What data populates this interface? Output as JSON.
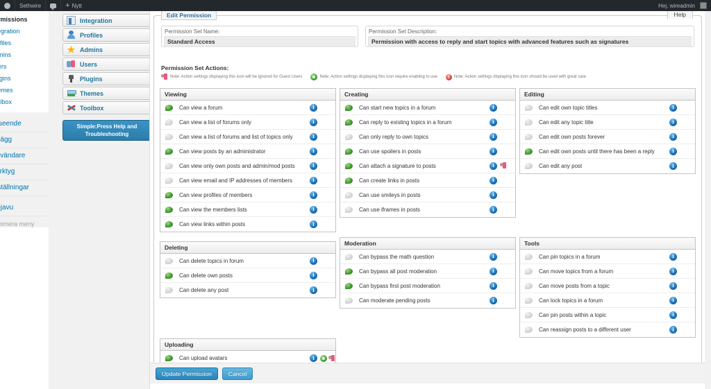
{
  "adminbar": {
    "site_name": "Sethwire",
    "comments_icon": "comment-icon",
    "new_label": "Nytt",
    "greeting": "Hej, wireadmin",
    "wp_logo_icon": "wordpress-logo-icon",
    "avatar_icon": "avatar-icon"
  },
  "wpmenu": {
    "submenu": [
      {
        "label": "Permissions",
        "current": true
      },
      {
        "label": "Integration",
        "current": false
      },
      {
        "label": "Profiles",
        "current": false
      },
      {
        "label": "Admins",
        "current": false
      },
      {
        "label": "Users",
        "current": false
      },
      {
        "label": "Plugins",
        "current": false
      },
      {
        "label": "Themes",
        "current": false
      },
      {
        "label": "Toolbox",
        "current": false
      }
    ],
    "lower": [
      {
        "label": "Utseende"
      },
      {
        "label": "Tillägg"
      },
      {
        "label": "Användare"
      },
      {
        "label": "Verktyg"
      },
      {
        "label": "Inställningar"
      }
    ],
    "plugin_menu": {
      "label": "Dejavu"
    },
    "collapse": {
      "label": "Minimera meny"
    }
  },
  "spnav": {
    "items": [
      {
        "label": "Integration",
        "icon": "integration-icon"
      },
      {
        "label": "Profiles",
        "icon": "profiles-icon"
      },
      {
        "label": "Admins",
        "icon": "admins-star-icon"
      },
      {
        "label": "Users",
        "icon": "users-icon"
      },
      {
        "label": "Plugins",
        "icon": "plugins-plug-icon"
      },
      {
        "label": "Themes",
        "icon": "themes-icon"
      },
      {
        "label": "Toolbox",
        "icon": "toolbox-icon"
      }
    ],
    "help_button": "Simple:Press Help and Troubleshooting"
  },
  "panel": {
    "tab_label": "Edit Permission",
    "help_tab": "Help",
    "name_label": "Permission Set Name:",
    "name_value": "Standard Access",
    "desc_label": "Permission Set Description:",
    "desc_value": "Permission with access to reply and start topics with advanced features such as signatures",
    "actions_title": "Permission Set Actions:",
    "notes": [
      {
        "icon": "guest-user-icon",
        "text": "Note: Action settings displaying this icon will be ignored for Guest Users"
      },
      {
        "icon": "gear-enable-icon",
        "text": "Note: Action settings displaying this icon require enabling to use"
      },
      {
        "icon": "warning-icon",
        "text": "Note: Action settings displaying this icon should be used with great care"
      }
    ],
    "update_button": "Update Permission",
    "cancel_button": "Cancel"
  },
  "colors": {
    "accent": "#2e6e9e",
    "enabled": "#3f9b32",
    "disabled": "#d6d6d6",
    "info": "#1b6fb5",
    "warning": "#d8453c",
    "guest": "#e75b7e",
    "adminbar": "#23282d"
  },
  "groups": {
    "viewing": {
      "title": "Viewing",
      "rows": [
        {
          "label": "Can view a forum",
          "enabled": true,
          "info": true,
          "extra": []
        },
        {
          "label": "Can view a list of forums only",
          "enabled": false,
          "info": true,
          "extra": []
        },
        {
          "label": "Can view a list of forums and list of topics only",
          "enabled": false,
          "info": true,
          "extra": []
        },
        {
          "label": "Can view posts by an administrator",
          "enabled": true,
          "info": true,
          "extra": []
        },
        {
          "label": "Can view only own posts and admin/mod posts",
          "enabled": false,
          "info": true,
          "extra": []
        },
        {
          "label": "Can view email and IP addresses of members",
          "enabled": false,
          "info": true,
          "extra": []
        },
        {
          "label": "Can view profiles of members",
          "enabled": true,
          "info": true,
          "extra": []
        },
        {
          "label": "Can view the members lists",
          "enabled": true,
          "info": true,
          "extra": []
        },
        {
          "label": "Can view links within posts",
          "enabled": true,
          "info": true,
          "extra": []
        }
      ]
    },
    "creating": {
      "title": "Creating",
      "rows": [
        {
          "label": "Can start new topics in a forum",
          "enabled": true,
          "info": true,
          "extra": []
        },
        {
          "label": "Can reply to existing topics in a forum",
          "enabled": true,
          "info": true,
          "extra": []
        },
        {
          "label": "Can only reply to own topics",
          "enabled": false,
          "info": true,
          "extra": []
        },
        {
          "label": "Can use spoilers in posts",
          "enabled": true,
          "info": true,
          "extra": []
        },
        {
          "label": "Can attach a signature to posts",
          "enabled": true,
          "info": true,
          "extra": [
            "guest"
          ]
        },
        {
          "label": "Can create links in posts",
          "enabled": true,
          "info": true,
          "extra": []
        },
        {
          "label": "Can use smileys in posts",
          "enabled": false,
          "info": true,
          "extra": []
        },
        {
          "label": "Can use iframes in posts",
          "enabled": false,
          "info": true,
          "extra": []
        }
      ]
    },
    "editing": {
      "title": "Editing",
      "rows": [
        {
          "label": "Can edit own topic titles",
          "enabled": false,
          "info": true,
          "extra": []
        },
        {
          "label": "Can edit any topic title",
          "enabled": false,
          "info": true,
          "extra": []
        },
        {
          "label": "Can edit own posts forever",
          "enabled": false,
          "info": true,
          "extra": []
        },
        {
          "label": "Can edit own posts until there has been a reply",
          "enabled": true,
          "info": true,
          "extra": []
        },
        {
          "label": "Can edit any post",
          "enabled": false,
          "info": true,
          "extra": []
        }
      ]
    },
    "deleting": {
      "title": "Deleting",
      "rows": [
        {
          "label": "Can delete topics in forum",
          "enabled": false,
          "info": true,
          "extra": []
        },
        {
          "label": "Can delete own posts",
          "enabled": true,
          "info": true,
          "extra": []
        },
        {
          "label": "Can delete any post",
          "enabled": false,
          "info": true,
          "extra": []
        }
      ]
    },
    "moderation": {
      "title": "Moderation",
      "rows": [
        {
          "label": "Can bypass the math question",
          "enabled": false,
          "info": true,
          "extra": []
        },
        {
          "label": "Can bypass all post moderation",
          "enabled": true,
          "info": true,
          "extra": []
        },
        {
          "label": "Can bypass first post moderation",
          "enabled": true,
          "info": true,
          "extra": []
        },
        {
          "label": "Can moderate pending posts",
          "enabled": false,
          "info": true,
          "extra": []
        }
      ]
    },
    "tools": {
      "title": "Tools",
      "rows": [
        {
          "label": "Can pin topics in a forum",
          "enabled": false,
          "info": true,
          "extra": []
        },
        {
          "label": "Can move topics from a forum",
          "enabled": false,
          "info": true,
          "extra": []
        },
        {
          "label": "Can move posts from a topic",
          "enabled": false,
          "info": true,
          "extra": []
        },
        {
          "label": "Can lock topics in a forum",
          "enabled": false,
          "info": true,
          "extra": []
        },
        {
          "label": "Can pin posts within a topic",
          "enabled": false,
          "info": true,
          "extra": []
        },
        {
          "label": "Can reassign posts to a different user",
          "enabled": false,
          "info": true,
          "extra": []
        }
      ]
    },
    "uploading": {
      "title": "Uploading",
      "rows": [
        {
          "label": "Can upload avatars",
          "enabled": true,
          "info": true,
          "extra": [
            "gear",
            "guest"
          ]
        }
      ]
    }
  }
}
